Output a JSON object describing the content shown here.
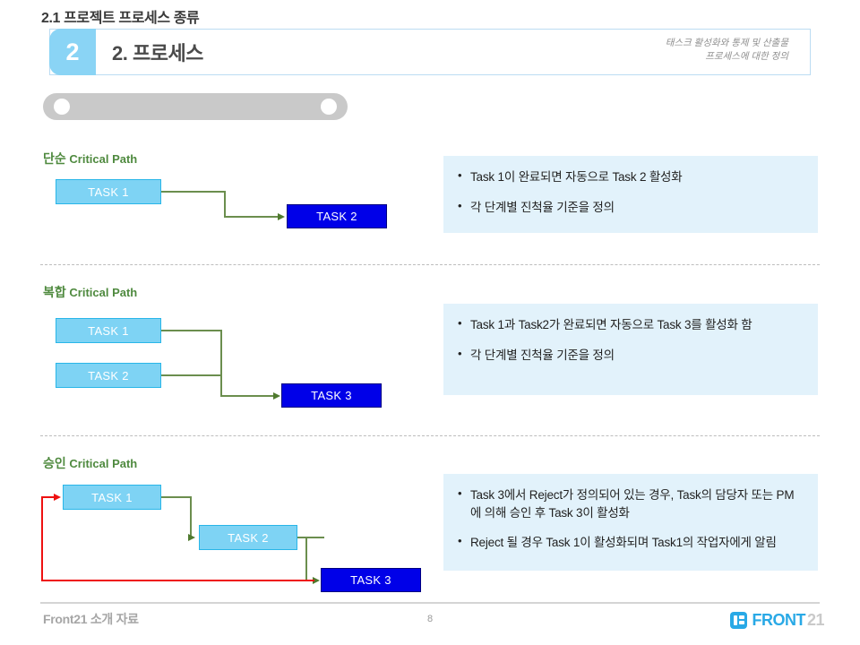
{
  "header": {
    "badge": "2",
    "title": "2. 프로세스",
    "note_line1": "태스크 활성화와 통제 및 산출물",
    "note_line2": "프로세스에 대한 정의"
  },
  "section": {
    "label": "2.1 프로젝트 프로세스 종류"
  },
  "blocks": [
    {
      "label_kr": "단순",
      "label_en": "Critical Path",
      "tasks": [
        {
          "name": "TASK 1",
          "style": "light"
        },
        {
          "name": "TASK 2",
          "style": "solid"
        }
      ],
      "callout": [
        "Task 1이 완료되면 자동으로 Task 2 활성화",
        "각 단계별 진척율 기준을 정의"
      ]
    },
    {
      "label_kr": "복합",
      "label_en": "Critical Path",
      "tasks": [
        {
          "name": "TASK 1",
          "style": "light"
        },
        {
          "name": "TASK 2",
          "style": "light"
        },
        {
          "name": "TASK 3",
          "style": "solid"
        }
      ],
      "callout": [
        "Task 1과 Task2가 완료되면 자동으로 Task 3를 활성화 함",
        "각 단계별 진척율 기준을 정의"
      ]
    },
    {
      "label_kr": "승인",
      "label_en": "Critical Path",
      "tasks": [
        {
          "name": "TASK 1",
          "style": "light"
        },
        {
          "name": "TASK 2",
          "style": "light"
        },
        {
          "name": "TASK 3",
          "style": "solid"
        }
      ],
      "callout": [
        "Task 3에서 Reject가 정의되어 있는 경우, Task의 담당자 또는 PM에 의해 승인 후 Task 3이 활성화",
        "Reject 될 경우 Task 1이 활성화되며 Task1의 작업자에게 알림"
      ]
    }
  ],
  "footer": {
    "text": "Front21 소개 자료",
    "page": "8",
    "logo_front": "FRONT",
    "logo_suffix": "21"
  },
  "colors": {
    "badge": "#8ad4f5",
    "task_light": "#7ed3f4",
    "task_light_border": "#29b6e8",
    "task_solid": "#0000e8",
    "connector_green": "#6b8e4e",
    "connector_red": "#ee1111",
    "callout_bg": "#e2f2fb",
    "label_green": "#4f8a3f",
    "section_bar": "#c9c9c9",
    "logo_blue": "#29a9e6"
  }
}
